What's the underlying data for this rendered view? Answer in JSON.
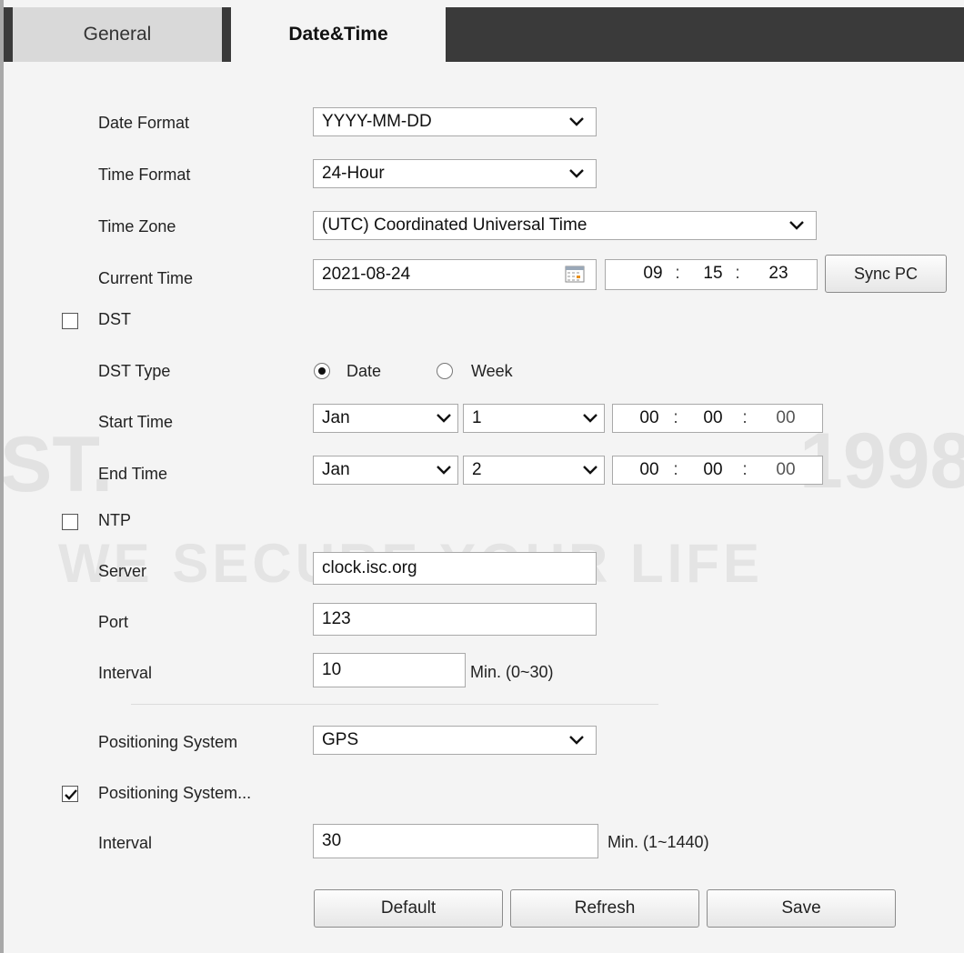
{
  "tabs": [
    {
      "label": "General",
      "active": false
    },
    {
      "label": "Date&Time",
      "active": true
    }
  ],
  "watermark": {
    "slogan": "WE SECURE YOUR LIFE",
    "year": "1998",
    "est": "ST."
  },
  "labels": {
    "date_format": "Date Format",
    "time_format": "Time Format",
    "time_zone": "Time Zone",
    "current_time": "Current Time",
    "dst": "DST",
    "dst_type": "DST Type",
    "start_time": "Start Time",
    "end_time": "End Time",
    "ntp": "NTP",
    "server": "Server",
    "port": "Port",
    "interval": "Interval",
    "positioning_system": "Positioning System",
    "positioning_system_enable": "Positioning System...",
    "interval2": "Interval"
  },
  "values": {
    "date_format": "YYYY-MM-DD",
    "time_format": "24-Hour",
    "time_zone": "(UTC) Coordinated Universal Time",
    "current_date": "2021-08-24",
    "current_time": {
      "h": "09",
      "m": "15",
      "s": "23"
    },
    "dst_checked": false,
    "dst_type_options": [
      "Date",
      "Week"
    ],
    "dst_type_selected": "Date",
    "start_month": "Jan",
    "start_day": "1",
    "start_time": {
      "h": "00",
      "m": "00",
      "s": "00"
    },
    "end_month": "Jan",
    "end_day": "2",
    "end_time": {
      "h": "00",
      "m": "00",
      "s": "00"
    },
    "ntp_checked": false,
    "server": "clock.isc.org",
    "port": "123",
    "interval": "10",
    "interval_hint": "Min. (0~30)",
    "positioning_system": "GPS",
    "positioning_enabled": true,
    "interval2": "30",
    "interval2_hint": "Min. (1~1440)"
  },
  "separator": ":",
  "buttons": {
    "sync_pc": "Sync PC",
    "default": "Default",
    "refresh": "Refresh",
    "save": "Save"
  },
  "colors": {
    "tab_bar": "#3a3a3a",
    "active_tab": "#f4f4f4",
    "inactive_tab": "#d9d9d9",
    "panel": "#f4f4f4"
  }
}
